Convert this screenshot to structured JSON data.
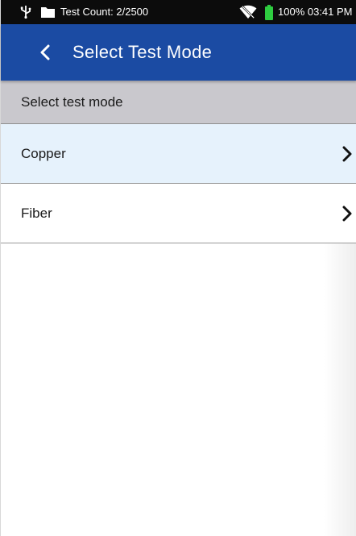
{
  "status_bar": {
    "usb_icon": "usb-icon",
    "folder_icon": "folder-icon",
    "test_count": "Test Count: 2/2500",
    "wifi_icon": "wifi-off-icon",
    "battery_icon": "battery-icon",
    "battery_color": "#2ecc40",
    "battery_and_time": "100% 03:41 PM"
  },
  "app_bar": {
    "back_icon": "chevron-left-icon",
    "title": "Select Test Mode",
    "color": "#1b4ba3"
  },
  "section_header": {
    "label": "Select test mode"
  },
  "options": [
    {
      "label": "Copper",
      "selected": true,
      "icon": "chevron-right-icon"
    },
    {
      "label": "Fiber",
      "selected": false,
      "icon": "chevron-right-icon"
    }
  ]
}
